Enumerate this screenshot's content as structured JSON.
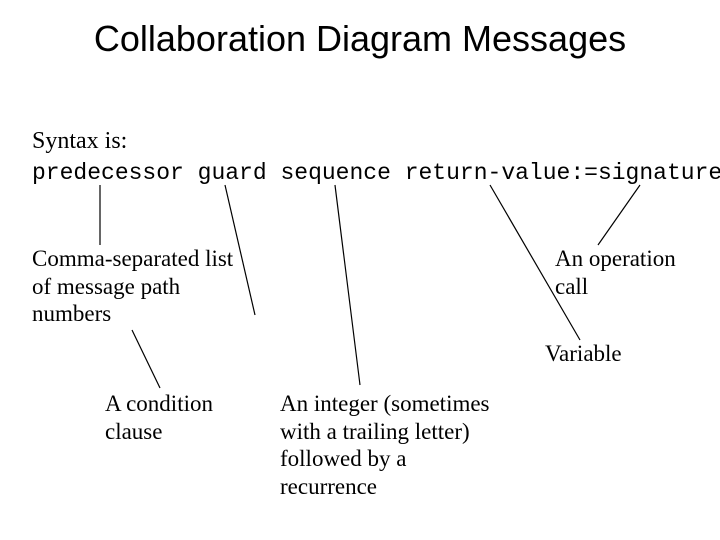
{
  "title": "Collaboration Diagram Messages",
  "syntax_label": "Syntax is:",
  "syntax": {
    "predecessor": "predecessor",
    "space1": " ",
    "guard": "guard",
    "space2": " ",
    "sequence": "sequence",
    "space3": " ",
    "return_value": "return-value",
    "sep": ":=",
    "signature": "signature"
  },
  "annotations": {
    "predecessor": "Comma-separated list\nof message path\nnumbers",
    "guard": "A condition\nclause",
    "sequence": "An integer (sometimes\nwith a trailing letter)\nfollowed by a\nrecurrence",
    "return_value": "Variable",
    "signature": "An operation\ncall"
  }
}
